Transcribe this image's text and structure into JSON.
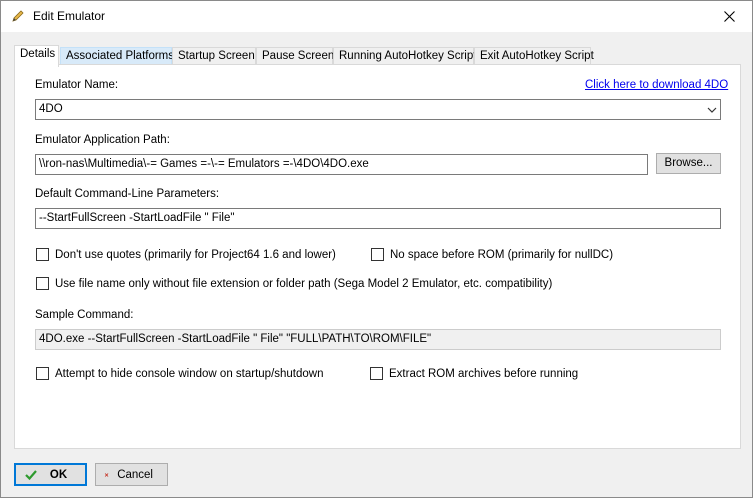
{
  "window": {
    "title": "Edit Emulator"
  },
  "tabs": [
    {
      "label": "Details"
    },
    {
      "label": "Associated Platforms"
    },
    {
      "label": "Startup Screen"
    },
    {
      "label": "Pause Screen"
    },
    {
      "label": "Running AutoHotkey Script"
    },
    {
      "label": "Exit AutoHotkey Script"
    }
  ],
  "details": {
    "emulator_name_label": "Emulator Name:",
    "download_link": "Click here to download 4DO",
    "emulator_name_value": "4DO",
    "app_path_label": "Emulator Application Path:",
    "app_path_value": "\\\\ron-nas\\Multimedia\\-= Games =-\\-= Emulators =-\\4DO\\4DO.exe",
    "browse_label": "Browse...",
    "params_label": "Default Command-Line Parameters:",
    "params_value": "--StartFullScreen -StartLoadFile \" File\"",
    "chk_no_quotes": "Don't use quotes (primarily for Project64 1.6 and lower)",
    "chk_no_space": "No space before ROM (primarily for nullDC)",
    "chk_filename_only": "Use file name only without file extension or folder path (Sega Model 2 Emulator, etc. compatibility)",
    "sample_label": "Sample Command:",
    "sample_value": "4DO.exe --StartFullScreen -StartLoadFile \" File\" \"FULL\\PATH\\TO\\ROM\\FILE\"",
    "chk_hide_console": "Attempt to hide console window on startup/shutdown",
    "chk_extract_rom": "Extract ROM archives before running"
  },
  "buttons": {
    "ok": "OK",
    "cancel": "Cancel"
  },
  "colors": {
    "accent": "#0078d7",
    "link": "#0000ee",
    "ok_check": "#2e9a2e",
    "cancel_x": "#c42b1c"
  }
}
